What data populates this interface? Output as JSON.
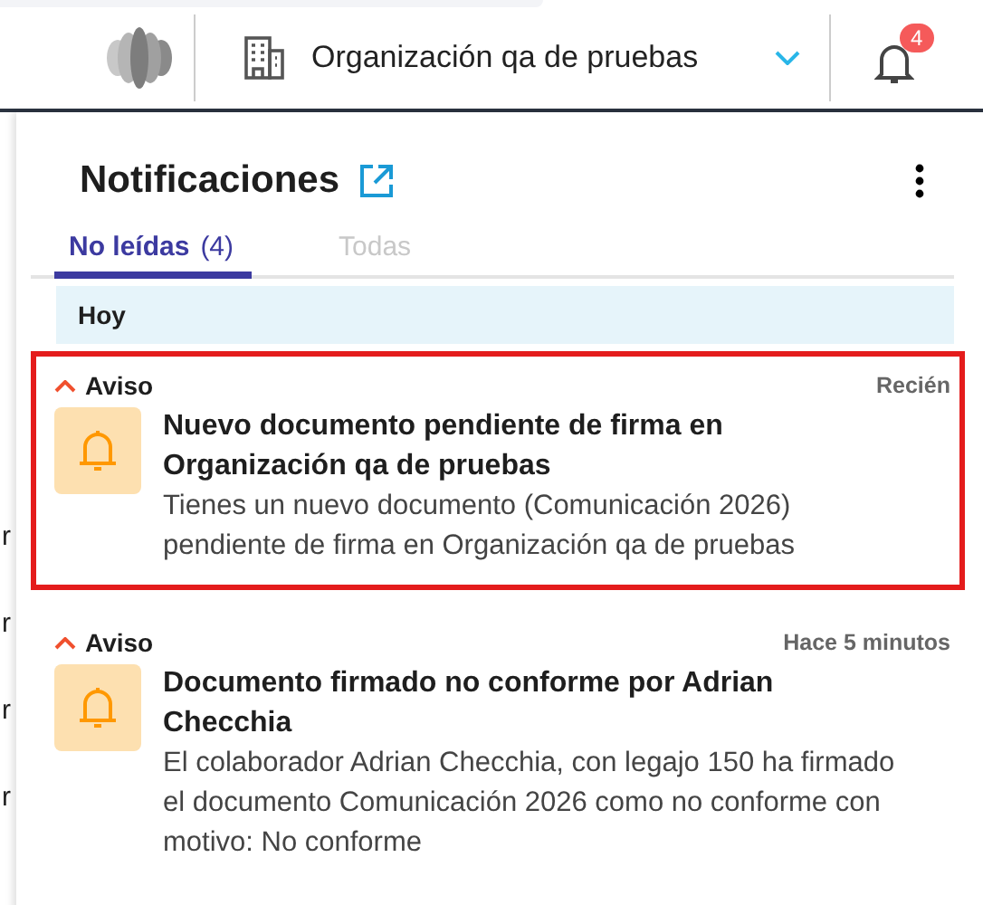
{
  "topbar": {
    "organization": "Organización qa de pruebas",
    "notification_count": "4"
  },
  "background_cells": [
    "r",
    "r",
    "r",
    "r"
  ],
  "panel": {
    "title": "Notificaciones",
    "tabs": [
      {
        "label": "No leídas",
        "count": "(4)",
        "selected": true
      },
      {
        "label": "Todas",
        "selected": false
      }
    ],
    "groups": [
      {
        "label": "Hoy",
        "notifications": [
          {
            "category": "Aviso",
            "time": "Recién",
            "highlighted": true,
            "title": "Nuevo documento pendiente de firma en Organización qa de pruebas",
            "body": "Tienes un nuevo documento (Comunicación 2026) pendiente de firma en Organización qa de pruebas"
          },
          {
            "category": "Aviso",
            "time": "Hace 5 minutos",
            "highlighted": false,
            "title": "Documento firmado no conforme por Adrian Checchia",
            "body": "El colaborador Adrian Checchia, con legajo 150 ha firmado el documento Comunicación 2026 como no conforme con motivo: No conforme"
          }
        ]
      }
    ]
  }
}
